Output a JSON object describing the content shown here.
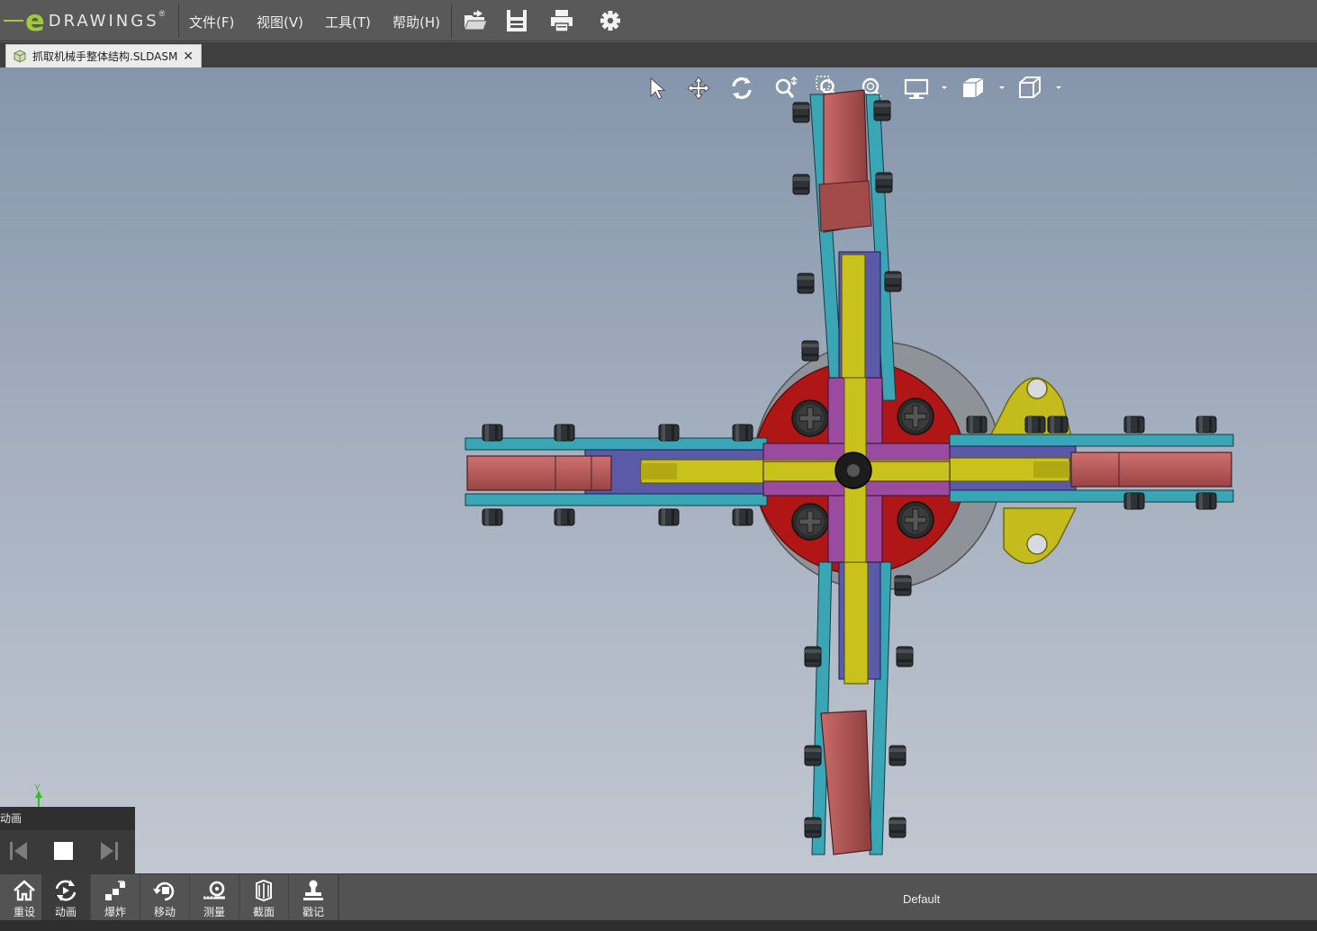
{
  "app": {
    "logo_letter": "e",
    "logo_word": "DRAWINGS",
    "logo_mark": "®"
  },
  "menu": {
    "items": [
      {
        "label": "文件(F)"
      },
      {
        "label": "视图(V)"
      },
      {
        "label": "工具(T)"
      },
      {
        "label": "帮助(H)"
      }
    ]
  },
  "toolbar_icons": [
    "open-icon",
    "save-icon",
    "print-icon",
    "settings-gear-icon"
  ],
  "tab": {
    "filename": "抓取机械手整体结构.SLDASM",
    "close_glyph": "✕"
  },
  "heads_up_icons": [
    "select-arrow-icon",
    "pan-icon",
    "rotate-icon",
    "zoom-icon",
    "zoom-to-area-icon",
    "zoom-to-fit-icon",
    "display-style-icon",
    "shaded-icon",
    "view-orientation-icon"
  ],
  "axis_indicator": {
    "label": "Y"
  },
  "animation": {
    "title": "动画",
    "controls": [
      "previous-icon",
      "stop-icon",
      "next-icon"
    ]
  },
  "bottom_tools": [
    {
      "label": "重设",
      "icon": "home-icon",
      "active": false
    },
    {
      "label": "动画",
      "icon": "animation-icon",
      "active": true
    },
    {
      "label": "爆炸",
      "icon": "explode-icon",
      "active": false
    },
    {
      "label": "移动",
      "icon": "move-icon",
      "active": false
    },
    {
      "label": "测量",
      "icon": "measure-icon",
      "active": false
    },
    {
      "label": "截面",
      "icon": "section-icon",
      "active": false
    },
    {
      "label": "戳记",
      "icon": "stamp-icon",
      "active": false
    }
  ],
  "configuration": {
    "name": "Default"
  },
  "colors": {
    "accent_green": "#9ccc3c",
    "link_teal": "#3aa6b5",
    "gripper_red": "#b85a5a",
    "bar_yellow": "#c9c21c",
    "cross_purple": "#9b4b9f",
    "base_red": "#b01616"
  }
}
